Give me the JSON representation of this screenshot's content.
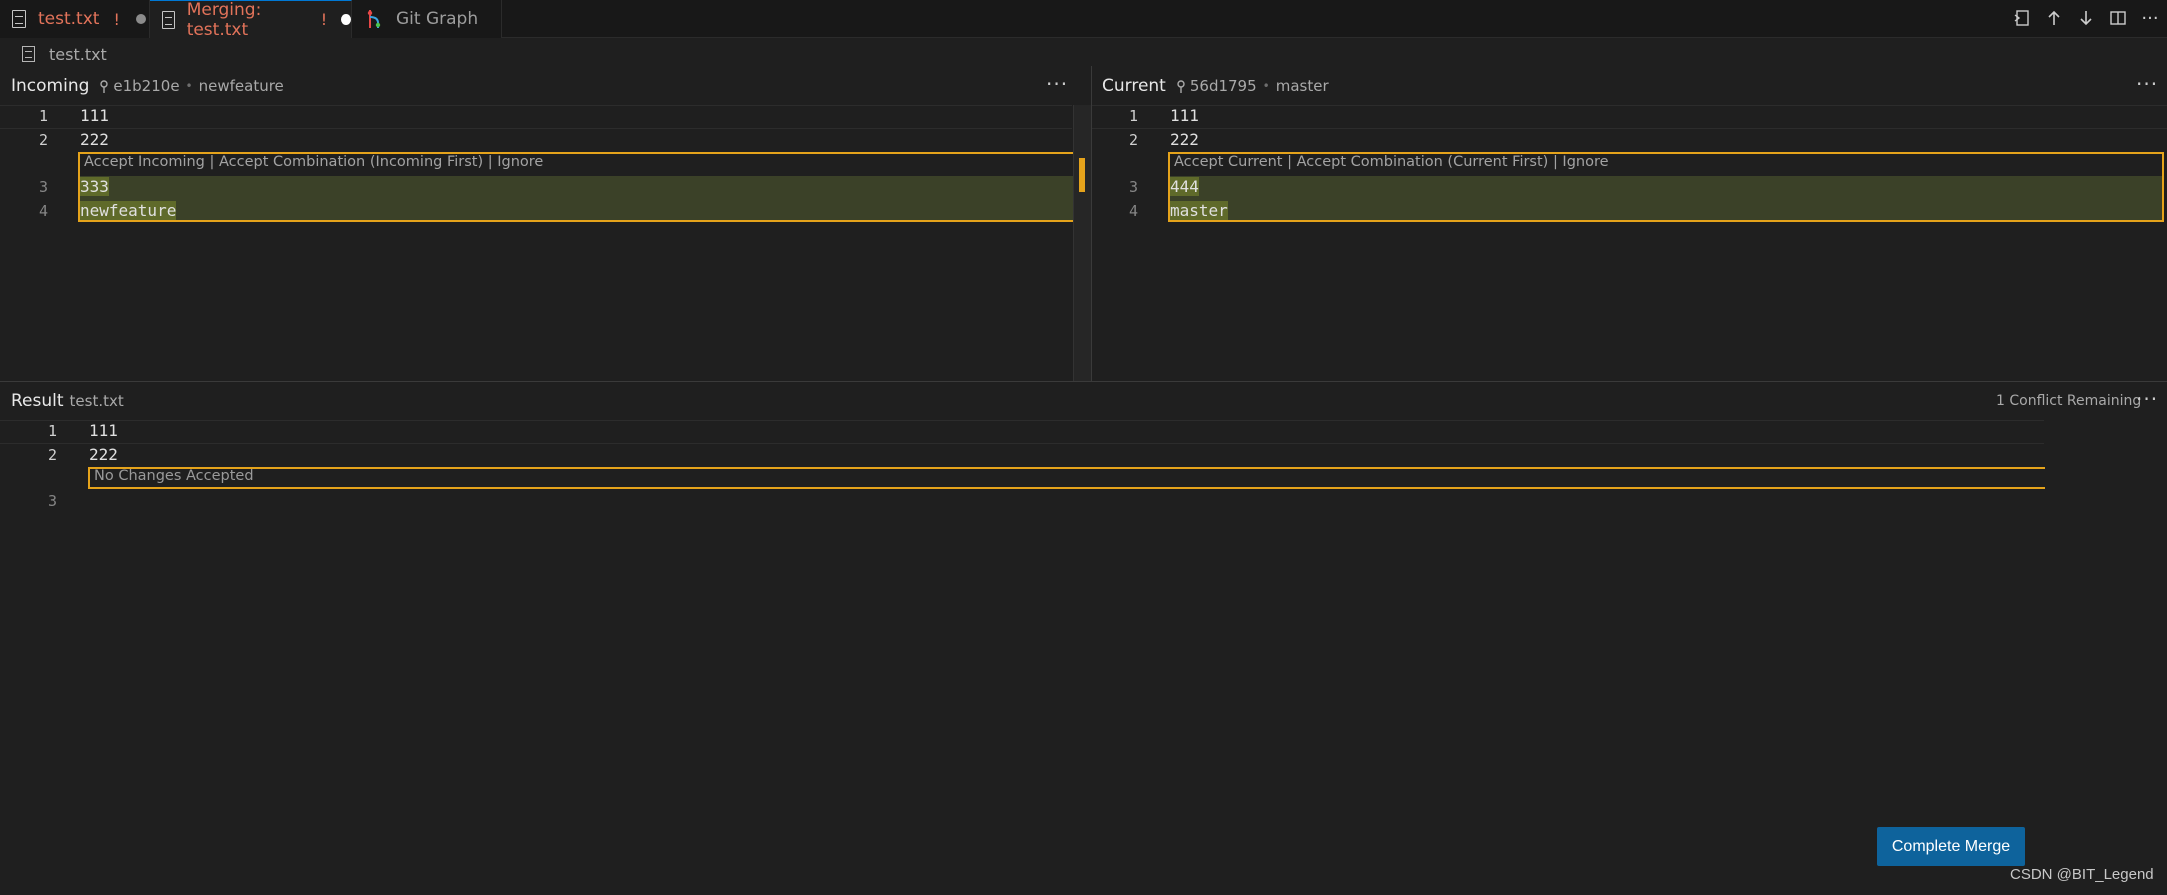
{
  "tabs": [
    {
      "label": "test.txt",
      "status": "!"
    },
    {
      "label": "Merging: test.txt",
      "status": "!"
    },
    {
      "label": "Git Graph"
    }
  ],
  "toolbar": {
    "icons": [
      "open-changes-icon",
      "arrow-up-icon",
      "arrow-down-icon",
      "split-editor-icon",
      "more-actions-icon"
    ]
  },
  "breadcrumb": {
    "file": "test.txt"
  },
  "incoming": {
    "title": "Incoming",
    "commit": "e1b210e",
    "branch": "newfeature",
    "codelens": "Accept Incoming | Accept Combination (Incoming First) | Ignore",
    "lines": [
      {
        "num": "1",
        "text": "111"
      },
      {
        "num": "2",
        "text": "222"
      },
      {
        "num": "3",
        "text": "333"
      },
      {
        "num": "4",
        "text": "newfeature"
      }
    ]
  },
  "current": {
    "title": "Current",
    "commit": "56d1795",
    "branch": "master",
    "codelens": "Accept Current | Accept Combination (Current First) | Ignore",
    "lines": [
      {
        "num": "1",
        "text": "111"
      },
      {
        "num": "2",
        "text": "222"
      },
      {
        "num": "3",
        "text": "444"
      },
      {
        "num": "4",
        "text": "master"
      }
    ]
  },
  "result": {
    "title": "Result",
    "file": "test.txt",
    "status": "1 Conflict Remaining",
    "placeholder": "No Changes Accepted",
    "lines": [
      {
        "num": "1",
        "text": "111"
      },
      {
        "num": "2",
        "text": "222"
      },
      {
        "num": "3",
        "text": ""
      }
    ]
  },
  "actions": {
    "complete_merge": "Complete Merge"
  },
  "watermark": "CSDN @BIT_Legend",
  "colors": {
    "conflict": "#e5a31b",
    "accent": "#0e639c",
    "tab_error": "#e2735a"
  }
}
